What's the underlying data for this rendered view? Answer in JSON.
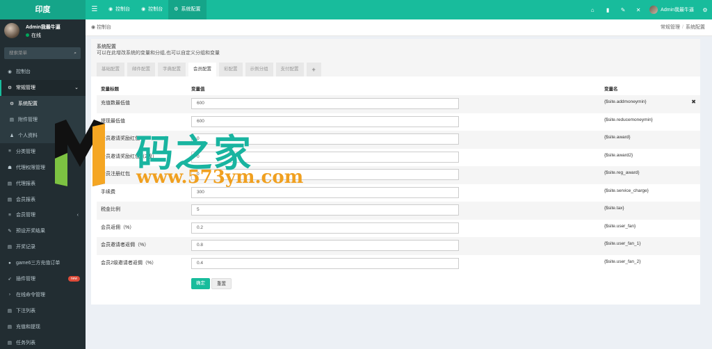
{
  "app": {
    "title": "印度"
  },
  "topbar": {
    "tabs": [
      {
        "label": "控制台",
        "icon": "dashboard-icon"
      },
      {
        "label": "控制台",
        "icon": "dashboard-icon"
      },
      {
        "label": "系统配置",
        "icon": "gear-icon"
      }
    ],
    "user": "Admin我最牛逼"
  },
  "sidebar": {
    "user_name": "Admin我最牛逼",
    "status": "在线",
    "search_placeholder": "搜索菜单",
    "items": [
      {
        "label": "控制台",
        "icon": "dashboard-icon"
      },
      {
        "label": "常规管理",
        "icon": "cogs-icon"
      },
      {
        "label": "系统配置",
        "icon": "gear-icon"
      },
      {
        "label": "附件管理",
        "icon": "file-icon"
      },
      {
        "label": "个人资料",
        "icon": "user-icon"
      },
      {
        "label": "分类管理",
        "icon": "list-icon"
      },
      {
        "label": "代理权限管理",
        "icon": "group-icon"
      },
      {
        "label": "代理报表",
        "icon": "file-icon"
      },
      {
        "label": "会员报表",
        "icon": "file-icon"
      },
      {
        "label": "会员管理",
        "icon": "list-icon"
      },
      {
        "label": "预设开奖结果",
        "icon": "edit-icon"
      },
      {
        "label": "开奖记录",
        "icon": "file-icon"
      },
      {
        "label": "game6三方充值订单",
        "icon": "circle-icon"
      },
      {
        "label": "插件管理",
        "icon": "rocket-icon",
        "badge": "new"
      },
      {
        "label": "在线命令管理",
        "icon": "terminal-icon"
      },
      {
        "label": "下注列表",
        "icon": "file-icon"
      },
      {
        "label": "充值和提现",
        "icon": "file-icon"
      },
      {
        "label": "任务列表",
        "icon": "file-icon"
      }
    ]
  },
  "breadcrumb": {
    "left": "控制台",
    "right": [
      "常规管理",
      "系统配置"
    ]
  },
  "panel": {
    "title": "系统配置",
    "subtitle": "可以在此增改系统的变量和分组,也可以自定义分组和变量",
    "tabs": [
      "基础配置",
      "邮件配置",
      "字典配置",
      "会员配置",
      "彩配置",
      "示例分组",
      "支付配置",
      "+"
    ],
    "active_tab": 3,
    "headers": {
      "title": "变量标题",
      "value": "变量值",
      "name": "变量名"
    },
    "rows": [
      {
        "title": "充值数最低值",
        "value": "600",
        "name": "{$site.addmoneymin}"
      },
      {
        "title": "提现最低值",
        "value": "600",
        "name": "{$site.reducemoneymin}"
      },
      {
        "title": "会员邀请奖励红包",
        "value": "0",
        "name": "{$site.award}"
      },
      {
        "title": "会员邀请奖励红包（2级）",
        "value": "0",
        "name": "{$site.award2}"
      },
      {
        "title": "会员注册红包",
        "value": "0",
        "name": "{$site.reg_award}"
      },
      {
        "title": "手续费",
        "value": "300",
        "name": "{$site.service_charge}"
      },
      {
        "title": "税金比例",
        "value": "5",
        "name": "{$site.tax}"
      },
      {
        "title": "会员返佣（%）",
        "value": "0.2",
        "name": "{$site.user_fan}"
      },
      {
        "title": "会员邀请者返佣（%）",
        "value": "0.8",
        "name": "{$site.user_fan_1}"
      },
      {
        "title": "会员2级邀请者返佣（%）",
        "value": "0.4",
        "name": "{$site.user_fan_2}"
      }
    ],
    "buttons": {
      "submit": "确定",
      "reset": "重置"
    }
  },
  "watermark": {
    "title": "码之家",
    "url": "www.573ym.com"
  },
  "colors": {
    "brand": "#18bc9c",
    "sidebar": "#222d32",
    "watermark_green": "#19b4a0",
    "watermark_orange": "#f0a020"
  }
}
